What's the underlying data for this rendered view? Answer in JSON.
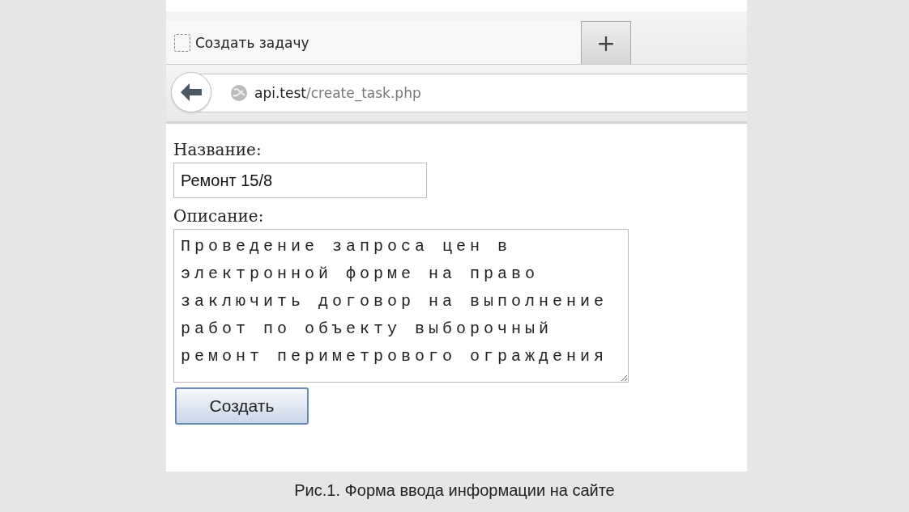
{
  "browser": {
    "tab": {
      "title": "Создать задачу",
      "selected": true
    },
    "new_tab_button": "+",
    "address": {
      "host": "api.test",
      "path": "/create_task.php"
    }
  },
  "form": {
    "fields": [
      {
        "kind": "input",
        "label": "Название:",
        "value": "Ремонт 15/8"
      },
      {
        "kind": "textarea",
        "label": "Описание:",
        "value": "Проведение запроса цен в электронной форме на право заключить договор на выполнение работ по объекту выборочный ремонт периметрового ограждения"
      }
    ],
    "submit_button": "Создать"
  },
  "caption": "Рис.1. Форма ввода информации на сайте"
}
